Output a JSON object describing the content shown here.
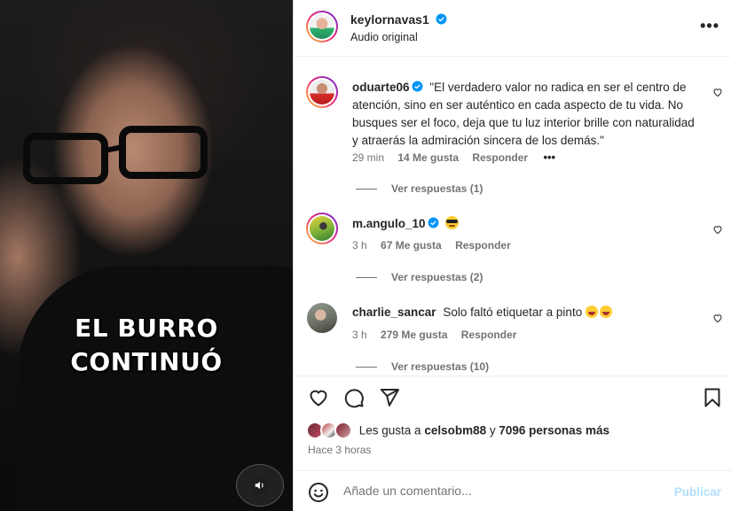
{
  "video": {
    "caption_line1": "EL BURRO",
    "caption_line2": "CONTINUÓ"
  },
  "post_header": {
    "username": "keylornavas1",
    "audio": "Audio original",
    "more": "•••"
  },
  "comments": [
    {
      "user": "oduarte06",
      "text": "\"El verdadero valor no radica en ser el centro de atención, sino en ser auténtico en cada aspecto de tu vida. No busques ser el foco, deja que tu luz interior brille con naturalidad y atraerás la admiración sincera de los demás.\"",
      "time": "29 min",
      "likes": "14 Me gusta",
      "reply": "Responder",
      "more": "•••",
      "replies": "Ver respuestas (1)"
    },
    {
      "user": "m.angulo_10",
      "text": "",
      "time": "3 h",
      "likes": "67 Me gusta",
      "reply": "Responder",
      "replies": "Ver respuestas (2)"
    },
    {
      "user": "charlie_sancar",
      "text": "Solo faltó etiquetar a pinto",
      "time": "3 h",
      "likes": "279 Me gusta",
      "reply": "Responder",
      "replies": "Ver respuestas (10)"
    }
  ],
  "likes_summary": {
    "prefix": "Les gusta a ",
    "user": "celsobm88",
    "middle": " y ",
    "others": "7096 personas más"
  },
  "posted_time": "Hace 3 horas",
  "add_comment": {
    "placeholder": "Añade un comentario...",
    "publish": "Publicar"
  },
  "icons": [
    "like-icon",
    "comment-icon",
    "share-icon",
    "save-icon",
    "emoji-icon",
    "verified-icon",
    "sound-icon"
  ],
  "colors": {
    "verified": "#0095f6",
    "publish_disabled": "#b2dffc",
    "secondary_text": "#737373"
  }
}
